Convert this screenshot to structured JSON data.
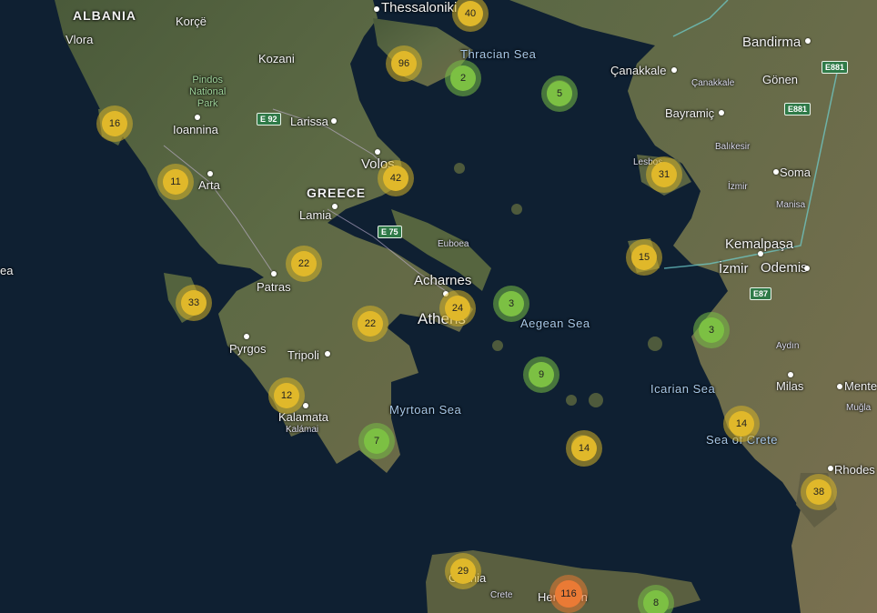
{
  "labels": {
    "albania": "ALBANIA",
    "vlora": "Vlora",
    "korce": "Korçë",
    "pindos": "Pindos\nNational\nPark",
    "ioannina": "Ioannina",
    "kozani": "Kozani",
    "larissa": "Larissa",
    "thessaloniki": "Thessaloniki",
    "thracian_sea": "Thracian Sea",
    "canakkale": "Çanakkale",
    "canakkale_small": "Çanakkale",
    "bandirma": "Bandirma",
    "gonen": "Gönen",
    "bayramic": "Bayramiç",
    "balikesir": "Balıkesir",
    "soma": "Soma",
    "izmir_small": "İzmir",
    "manisa": "Manisa",
    "kemalpasa": "Kemalpaşa",
    "izmir": "İzmir",
    "odemis": "Odemis",
    "aydin": "Aydın",
    "milas": "Milas",
    "mente": "Mente",
    "mugla": "Muğla",
    "rhodes": "Rhodes",
    "lesbos": "Lesbos",
    "volos": "Volos",
    "greece": "GREECE",
    "lamia": "Lamia",
    "arta": "Arta",
    "euboea": "Euboea",
    "acharnes": "Acharnes",
    "athens": "Athens",
    "patras": "Patras",
    "pyrgos": "Pyrgos",
    "tripoli": "Tripoli",
    "kalamata": "Kalamata",
    "kalamai": "Kalámai",
    "aegean_sea": "Aegean Sea",
    "myrtoan_sea": "Myrtoan Sea",
    "icarian_sea": "Icarian Sea",
    "sea_of_crete": "Sea of Crete",
    "chania": "Chania",
    "crete": "Crete",
    "heraklion": "Heraklion",
    "ionian": "ea"
  },
  "roads": {
    "e92": "E 92",
    "e75": "E 75",
    "e881a": "E881",
    "e881b": "E881",
    "e87": "E87"
  },
  "clusters": [
    {
      "count": "40",
      "color": "yellow"
    },
    {
      "count": "96",
      "color": "yellow"
    },
    {
      "count": "2",
      "color": "green"
    },
    {
      "count": "5",
      "color": "green"
    },
    {
      "count": "16",
      "color": "yellow"
    },
    {
      "count": "11",
      "color": "yellow"
    },
    {
      "count": "42",
      "color": "yellow"
    },
    {
      "count": "31",
      "color": "yellow"
    },
    {
      "count": "15",
      "color": "yellow"
    },
    {
      "count": "22",
      "color": "yellow"
    },
    {
      "count": "33",
      "color": "yellow"
    },
    {
      "count": "24",
      "color": "yellow"
    },
    {
      "count": "3",
      "color": "green"
    },
    {
      "count": "22",
      "color": "yellow"
    },
    {
      "count": "3",
      "color": "green"
    },
    {
      "count": "9",
      "color": "green"
    },
    {
      "count": "12",
      "color": "yellow"
    },
    {
      "count": "7",
      "color": "green"
    },
    {
      "count": "14",
      "color": "yellow"
    },
    {
      "count": "14",
      "color": "yellow"
    },
    {
      "count": "38",
      "color": "yellow"
    },
    {
      "count": "29",
      "color": "yellow"
    },
    {
      "count": "116",
      "color": "orange"
    },
    {
      "count": "8",
      "color": "green"
    }
  ]
}
